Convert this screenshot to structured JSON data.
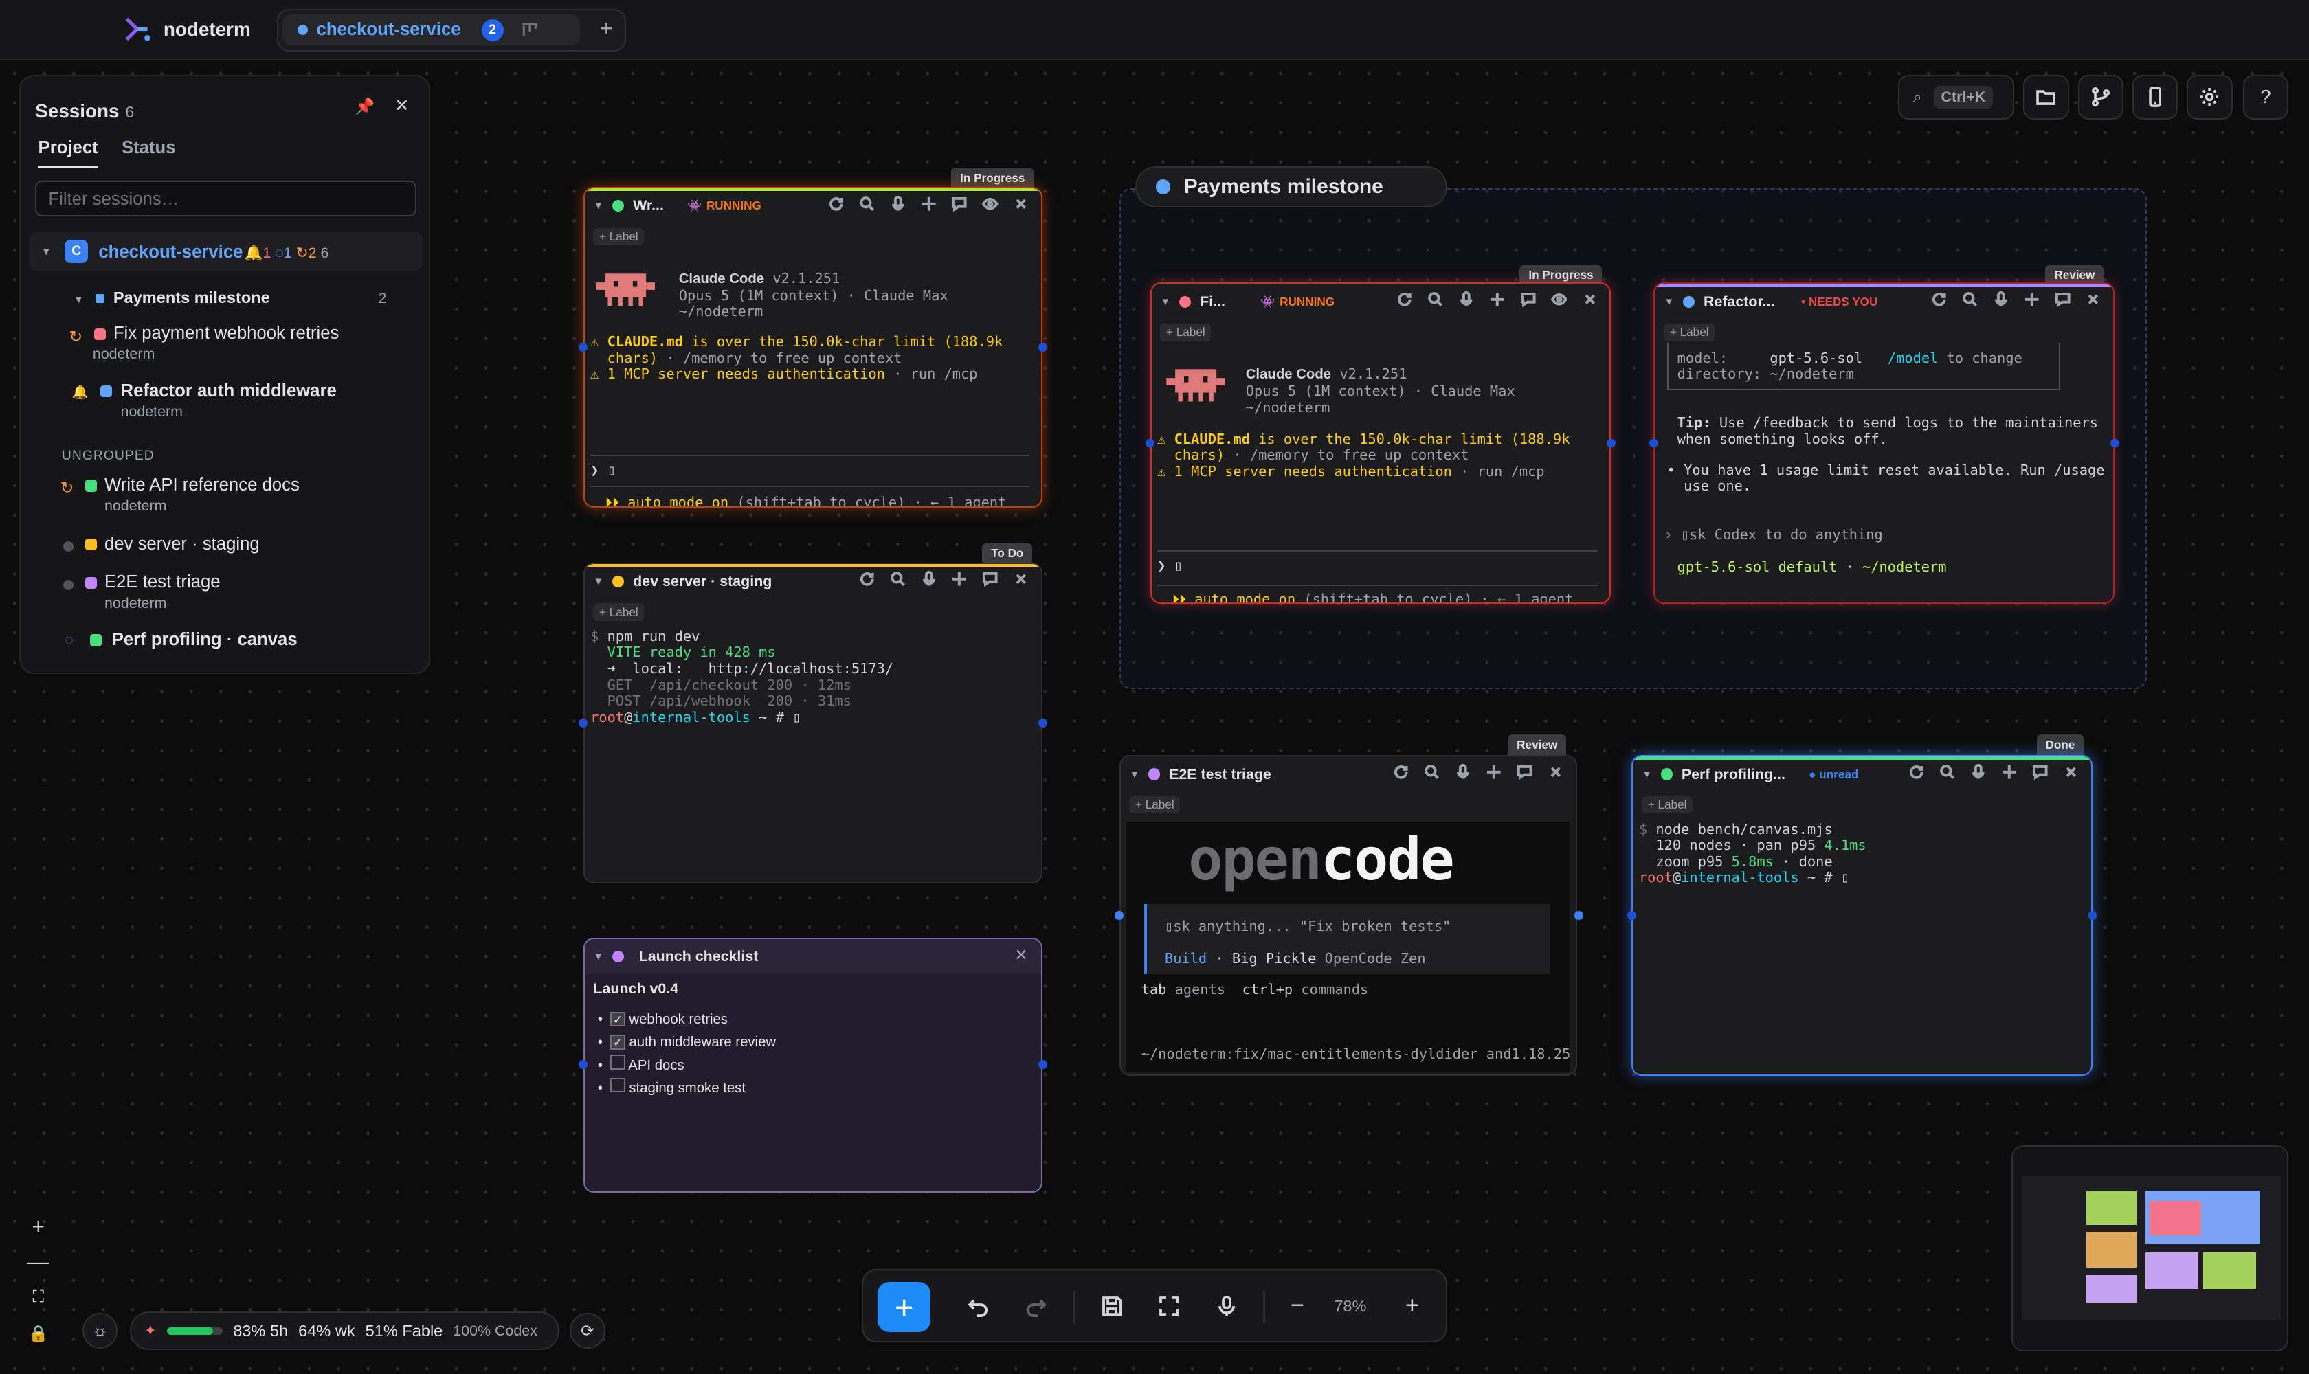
{
  "app": {
    "name": "nodeterm"
  },
  "tab": {
    "name": "checkout-service",
    "badge": "2"
  },
  "search": {
    "shortcut": "Ctrl+K"
  },
  "sessions": {
    "title": "Sessions",
    "count": "6",
    "tabs": [
      "Project",
      "Status"
    ],
    "filter_placeholder": "Filter sessions…",
    "project": {
      "initial": "C",
      "name": "checkout-service",
      "alerts": "1",
      "reviews": "1",
      "running": "2",
      "total": "6"
    },
    "group": {
      "name": "Payments milestone",
      "count": "2"
    },
    "items": [
      {
        "name": "Fix payment webhook retries",
        "sub": "nodeterm"
      },
      {
        "name": "Refactor auth middleware",
        "sub": "nodeterm"
      }
    ],
    "ungrouped_label": "UNGROUPED",
    "ungrouped": [
      {
        "name": "Write API reference docs",
        "sub": "nodeterm"
      },
      {
        "name": "dev server · staging",
        "sub": ""
      },
      {
        "name": "E2E test triage",
        "sub": "nodeterm"
      },
      {
        "name": "Perf profiling · canvas",
        "sub": ""
      }
    ]
  },
  "label_btn": "+ Label",
  "group_title": "Payments milestone",
  "windows": {
    "w1": {
      "title": "Wr...",
      "tag": "In Progress",
      "state": "RUNNING",
      "cc_name": "Claude Code",
      "cc_ver": "v2.1.251",
      "cc_model": "Opus 5 (1M context) · Claude Max",
      "cc_dir": "~/nodeterm",
      "warn1a": "CLAUDE.md",
      "warn1b": " is over the 150.0k-char limit (188.9k",
      "warn1c": "chars)",
      "warn1d": " · /memory to free up context",
      "warn2": "1 MCP server needs authentication",
      "warn2b": " · run /mcp",
      "prompt": "❯ ▯",
      "mode": "auto mode on",
      "mode2": " (shift+tab to cycle) · ← 1 agent"
    },
    "w2": {
      "title": "Fi...",
      "tag": "In Progress",
      "state": "RUNNING"
    },
    "w3": {
      "title": "Refactor...",
      "tag": "Review",
      "state": "NEEDS YOU",
      "l1a": "model:     ",
      "l1b": "gpt-5.6-sol",
      "l1c": "   /model",
      "l1d": " to change",
      "l2": "directory: ~/nodeterm",
      "tip1": "Tip:",
      "tip2": " Use /feedback to send logs to the maintainers",
      "tip3": "when something looks off.",
      "reset1": "• You have 1 usage limit reset available. Run /usage to",
      "reset2": "use one.",
      "ask": "› ▯sk Codex to do anything",
      "foot": "gpt-5.6-sol default · ~/nodeterm"
    },
    "w4": {
      "title": "dev server · staging",
      "tag": "To Do",
      "l1": "npm run dev",
      "l2a": "VITE",
      "l2b": " ready in 428 ms",
      "l3a": "➜  local:",
      "l3b": "   http://localhost:5173/",
      "l4": "GET  /api/checkout 200 · 12ms",
      "l5": "POST /api/webhook  200 · 31ms",
      "p1": "root",
      "p2": "@",
      "p3": "internal-tools",
      "p4": " ~ # ▯"
    },
    "w5": {
      "title": "Launch checklist",
      "heading": "Launch v0.4",
      "items": [
        "webhook retries",
        "auth middleware review",
        "API docs",
        "staging smoke test"
      ]
    },
    "w6": {
      "title": "E2E test triage",
      "tag": "Review",
      "logo1": "open",
      "logo2": "code",
      "ask": "▯sk anything... \"Fix broken tests\"",
      "build": "Build",
      "model": " · Big Pickle",
      "zen": " OpenCode Zen",
      "tab": "tab",
      "agents": " agents",
      "ctrlp": "  ctrl+p",
      "commands": " commands",
      "path": "~/nodeterm:fix/mac-entitlements-dyldider and1.18.25"
    },
    "w7": {
      "title": "Perf profiling...",
      "tag": "Done",
      "state": "unread",
      "l1": "node bench/canvas.mjs",
      "l2a": "  120 nodes · pan p95 ",
      "l2b": "4.1ms",
      "l3a": "  zoom p95 ",
      "l3b": "5.8ms",
      "l3c": " · done"
    }
  },
  "toolbar": {
    "zoom": "78%"
  },
  "usage": {
    "a": "83% 5h",
    "b": "64% wk",
    "c": "51% Fable",
    "d": "100% Codex",
    "progress": 0.83
  },
  "colors": {
    "accent": "#2563eb",
    "running": "#f97316",
    "needs": "#ef4444"
  }
}
